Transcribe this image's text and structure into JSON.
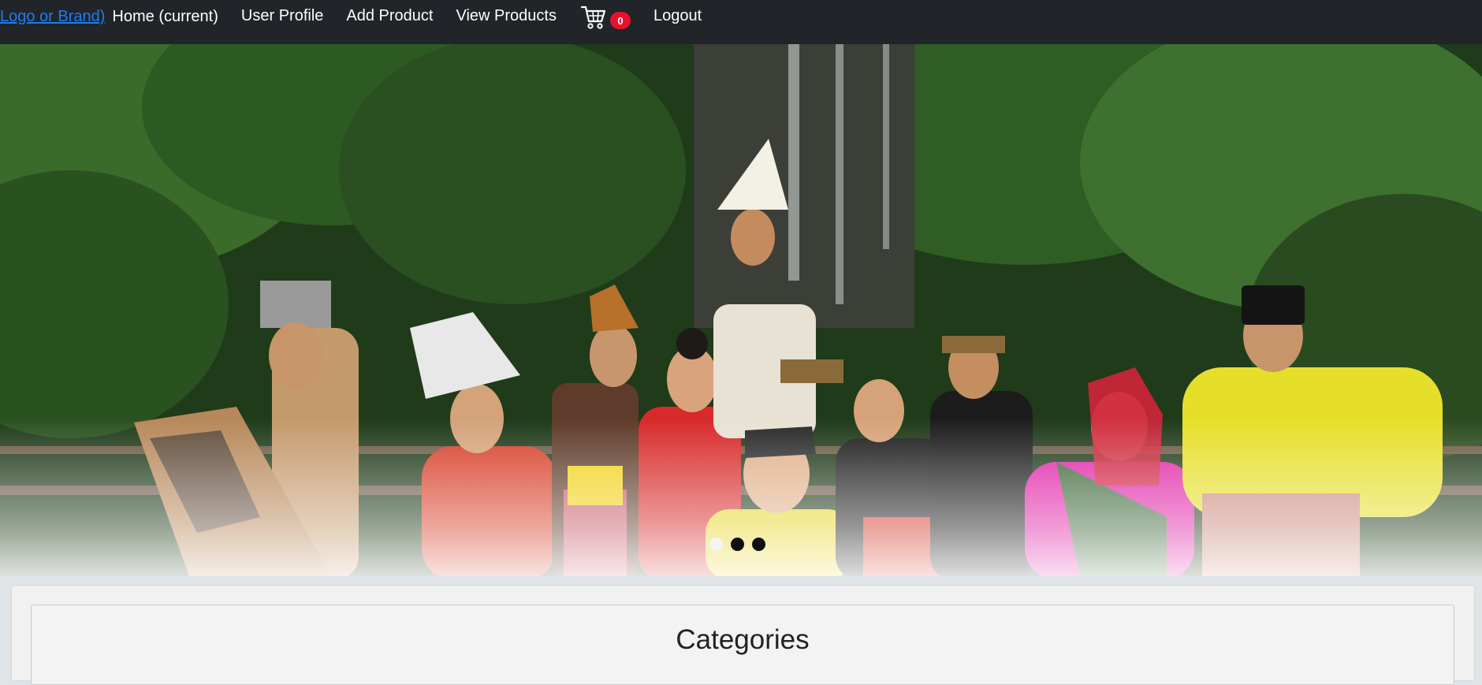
{
  "navbar": {
    "brand": "Logo or Brand)",
    "home": "Home (current)",
    "user_profile": "User Profile",
    "add_product": "Add Product",
    "view_products": "View Products",
    "cart_count": "0",
    "logout": "Logout"
  },
  "carousel": {
    "indicator_count": 3,
    "active_index": 0
  },
  "colors": {
    "navbar_bg": "#212428",
    "brand_link": "#1e7cf2",
    "cart_badge": "#e8112d"
  },
  "categories": {
    "title": "Categories"
  }
}
